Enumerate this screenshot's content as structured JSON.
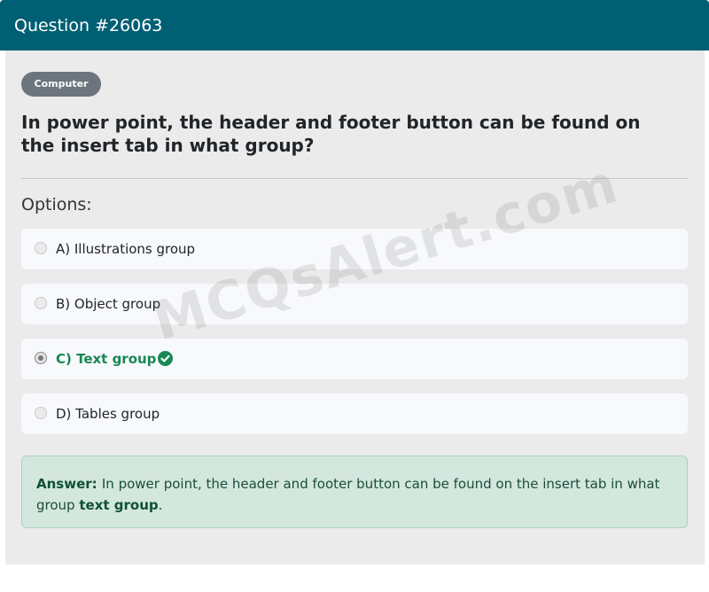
{
  "header": {
    "title": "Question #26063"
  },
  "category_badge": "Computer",
  "question_text": "In power point, the header and footer button can be found on the insert tab in what group?",
  "options_label": "Options:",
  "options": [
    {
      "label": "A) Illustrations group",
      "selected": false,
      "correct": false
    },
    {
      "label": "B) Object group",
      "selected": false,
      "correct": false
    },
    {
      "label": "C) Text group",
      "selected": true,
      "correct": true
    },
    {
      "label": "D) Tables group",
      "selected": false,
      "correct": false
    }
  ],
  "answer": {
    "prefix": "Answer:",
    "text": "In power point, the header and footer button can be found on the insert tab in what group",
    "highlight": "text group",
    "suffix": "."
  },
  "watermark": "MCQsAlert.com",
  "colors": {
    "header_bg": "#005f73",
    "badge_bg": "#6c757d",
    "correct_green": "#198754",
    "answer_bg": "#d3e7de"
  },
  "icons": {
    "correct": "check-circle-icon",
    "radio": "radio-icon"
  }
}
